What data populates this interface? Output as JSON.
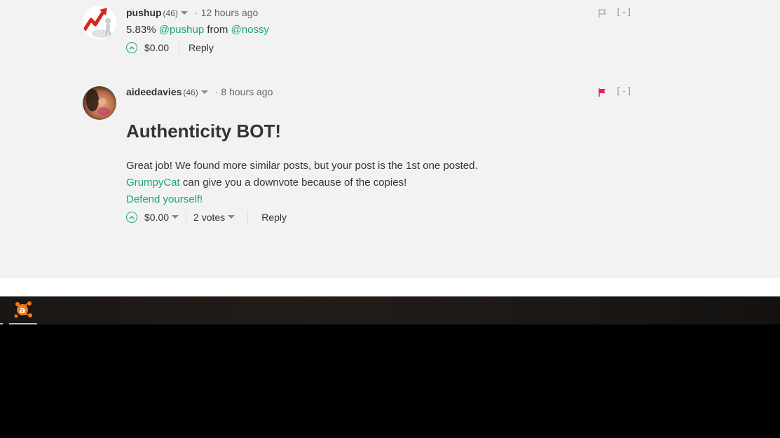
{
  "comments": [
    {
      "author": "pushup",
      "reputation": "(46)",
      "dot": "·",
      "time": "12 hours ago",
      "collapse": "[-]",
      "flag_color": "#aaaaaa",
      "body": {
        "percent": "5.83%",
        "mention1": "@pushup",
        "from": "from",
        "mention2": "@nossy"
      },
      "payout": "$0.00",
      "reply": "Reply"
    },
    {
      "author": "aideedavies",
      "reputation": "(46)",
      "dot": "·",
      "time": "8 hours ago",
      "collapse": "[-]",
      "flag_color": "#e0245e",
      "heading": "Authenticity BOT!",
      "line1": "Great job! We found more similar posts, but your post is the 1st one posted.",
      "line2_link": "GrumpyCat",
      "line2_rest": " can give you a downvote because of the copies!",
      "line3_link": "Defend yourself!",
      "payout": "$0.00",
      "votes": "2 votes",
      "reply": "Reply"
    }
  ],
  "taskbar": {
    "app_icon": "avast-icon",
    "app_letter": "a",
    "accent": "#f7780f"
  },
  "colors": {
    "link": "#1aa37a",
    "background": "#f2f2f2"
  }
}
